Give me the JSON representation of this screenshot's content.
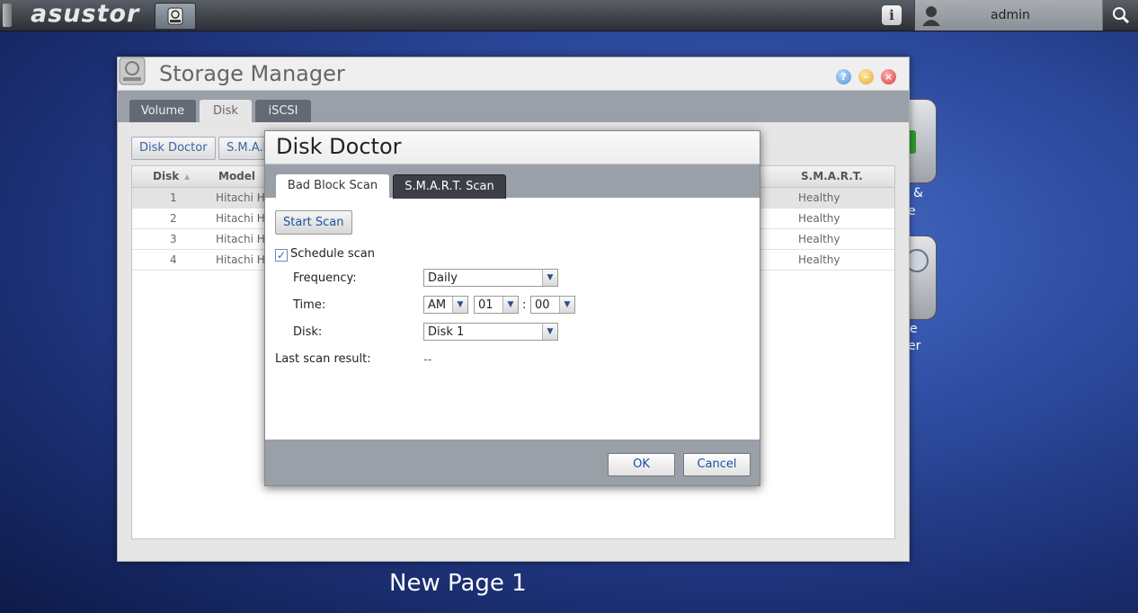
{
  "topbar": {
    "logo": "asustor",
    "user": "admin"
  },
  "desktop": {
    "icon_labels": [
      "&",
      "e",
      "e",
      "er"
    ]
  },
  "storage_manager": {
    "title": "Storage Manager",
    "tabs": [
      {
        "label": "Volume"
      },
      {
        "label": "Disk"
      },
      {
        "label": "iSCSI"
      }
    ],
    "toolbar": {
      "disk_doctor": "Disk Doctor",
      "smart": "S.M.A.R"
    },
    "grid": {
      "headers": {
        "disk": "Disk",
        "model": "Model",
        "smart": "S.M.A.R.T."
      },
      "sort_indicator": "▲",
      "rows": [
        {
          "disk": "1",
          "model": "Hitachi HD",
          "smart": "Healthy"
        },
        {
          "disk": "2",
          "model": "Hitachi HD",
          "smart": "Healthy"
        },
        {
          "disk": "3",
          "model": "Hitachi HD",
          "smart": "Healthy"
        },
        {
          "disk": "4",
          "model": "Hitachi HD",
          "smart": "Healthy"
        }
      ]
    }
  },
  "disk_doctor": {
    "title": "Disk Doctor",
    "tabs": {
      "bad_block": "Bad Block Scan",
      "smart_scan": "S.M.A.R.T. Scan"
    },
    "start_scan": "Start Scan",
    "schedule_label": "Schedule scan",
    "schedule_checked": true,
    "frequency_label": "Frequency:",
    "frequency_value": "Daily",
    "time_label": "Time:",
    "time_ampm": "AM",
    "time_hour": "01",
    "time_sep": ":",
    "time_minute": "00",
    "disk_label": "Disk:",
    "disk_value": "Disk 1",
    "last_result_label": "Last scan result:",
    "last_result_value": "--",
    "ok": "OK",
    "cancel": "Cancel"
  },
  "footer": {
    "page_label": "New Page 1"
  },
  "colors": {
    "accent": "#3b64a8",
    "result": "#3a8a3a"
  }
}
